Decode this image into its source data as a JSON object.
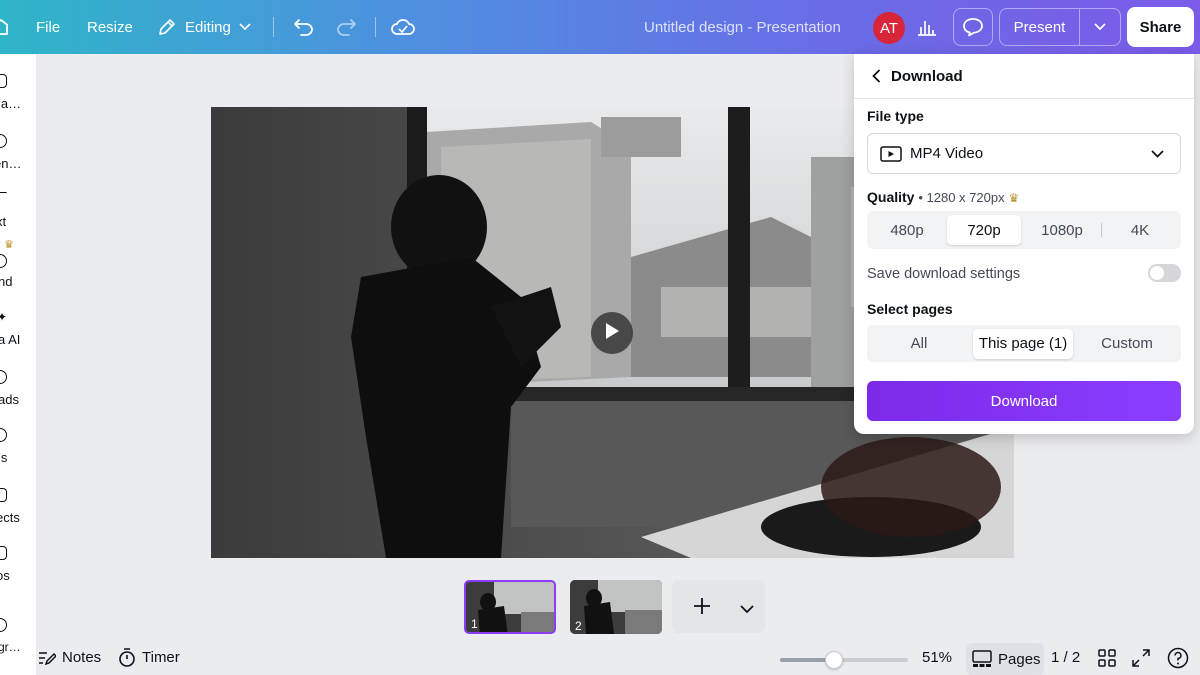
{
  "topbar": {
    "file_label": "File",
    "resize_label": "Resize",
    "editing_label": "Editing",
    "design_title": "Untitled design - Presentation",
    "avatar_initials": "AT",
    "present_label": "Present",
    "share_label": "Share"
  },
  "sidebar": {
    "items": [
      {
        "label": "la…"
      },
      {
        "label": "en…"
      },
      {
        "label": "xt"
      },
      {
        "label": "nd"
      },
      {
        "label": "a AI"
      },
      {
        "label": "ads"
      },
      {
        "label": "ls"
      },
      {
        "label": "ects"
      },
      {
        "label": "os"
      },
      {
        "label": "gr…"
      }
    ]
  },
  "pages": {
    "thumbnails": [
      {
        "number": "1",
        "selected": true
      },
      {
        "number": "2",
        "selected": false
      }
    ]
  },
  "bottombar": {
    "notes_label": "Notes",
    "timer_label": "Timer",
    "zoom_value": "51%",
    "zoom_fraction": 0.42,
    "pages_label": "Pages",
    "page_counter": "1 / 2"
  },
  "download_panel": {
    "title": "Download",
    "file_type_label": "File type",
    "file_type_value": "MP4 Video",
    "quality_label": "Quality",
    "quality_detail": "• 1280 x 720px",
    "quality_options": [
      "480p",
      "720p",
      "1080p",
      "4K"
    ],
    "quality_selected": "720p",
    "save_settings_label": "Save download settings",
    "save_settings_on": false,
    "select_pages_label": "Select pages",
    "page_options": [
      "All",
      "This page (1)",
      "Custom"
    ],
    "page_selected": "This page (1)",
    "download_button": "Download"
  },
  "colors": {
    "accent": "#8b3dff",
    "avatar": "#d9253a"
  }
}
